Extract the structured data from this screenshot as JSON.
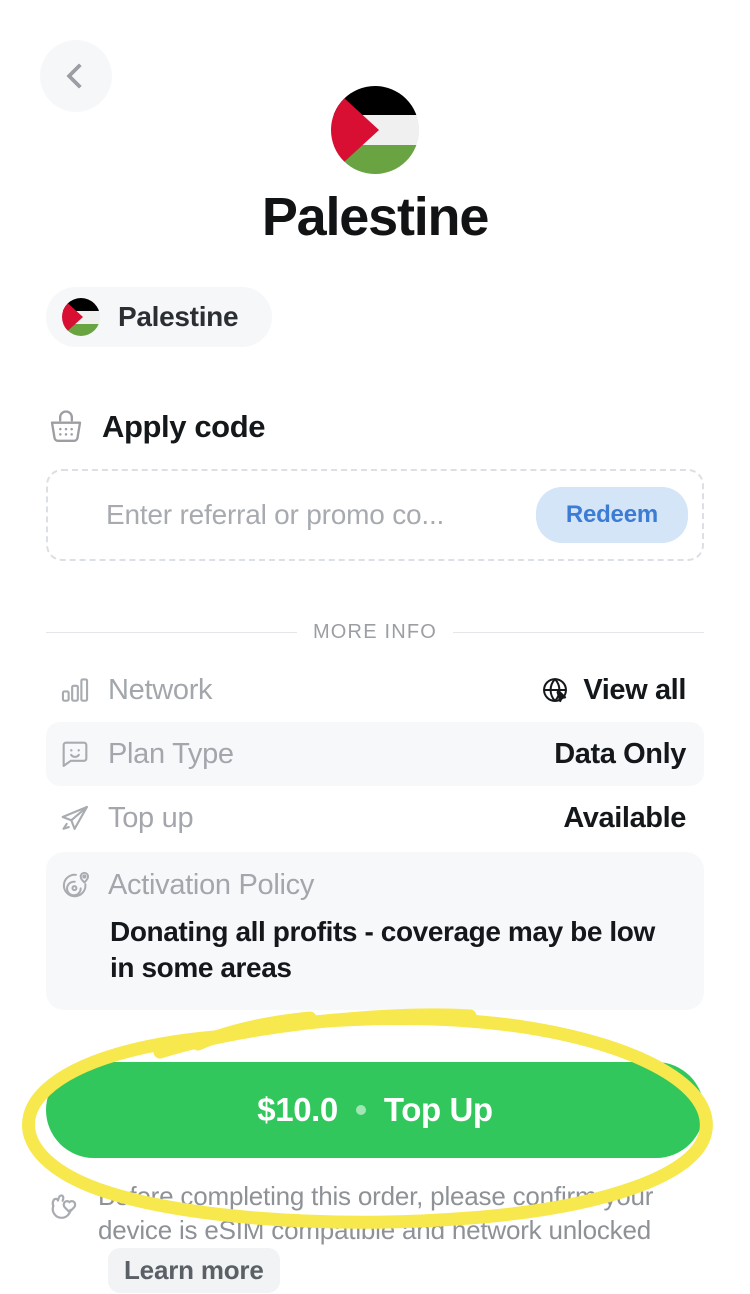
{
  "header": {
    "back_label": "Back",
    "back_icon": "chevron-left-icon",
    "title": "Palestine",
    "flag_icon": "palestine-flag-icon"
  },
  "country_chip": {
    "label": "Palestine",
    "flag_icon": "palestine-flag-icon"
  },
  "apply_code": {
    "title": "Apply code",
    "icon": "basket-icon",
    "input_value": "",
    "placeholder": "Enter referral or promo co...",
    "redeem_label": "Redeem"
  },
  "more_info": {
    "divider_label": "MORE INFO",
    "rows": [
      {
        "label": "Network",
        "icon": "signal-bars-icon",
        "value": "View all",
        "value_icon": "globe-search-icon",
        "shaded": false
      },
      {
        "label": "Plan Type",
        "icon": "chat-smiley-icon",
        "value": "Data Only",
        "value_icon": "",
        "shaded": true
      },
      {
        "label": "Top up",
        "icon": "paper-plane-icon",
        "value": "Available",
        "value_icon": "",
        "shaded": false
      }
    ],
    "policy": {
      "label": "Activation Policy",
      "icon": "radar-pin-icon",
      "text": "Donating all profits - coverage may be low in some areas"
    }
  },
  "cta": {
    "price": "$10.0",
    "action": "Top Up",
    "separator": "•",
    "color": "#32c75c"
  },
  "footer_note": {
    "icon": "hand-heart-icon",
    "text": "Before completing this order, please confirm your device is eSIM compatible and network unlocked",
    "learn_more_label": "Learn more"
  },
  "annotation": {
    "type": "hand-drawn-ellipse-highlight",
    "color": "#f7e84e",
    "target": "cta"
  },
  "colors": {
    "accent_green": "#32c75c",
    "redeem_bg": "#d3e5f7",
    "redeem_text": "#3d7cd4",
    "muted_text": "#a3a7ac",
    "flag_red": "#d80f33",
    "flag_green": "#6aa342",
    "flag_black": "#000000",
    "flag_white": "#f0f0f0",
    "highlight_yellow": "#f7e84e"
  }
}
